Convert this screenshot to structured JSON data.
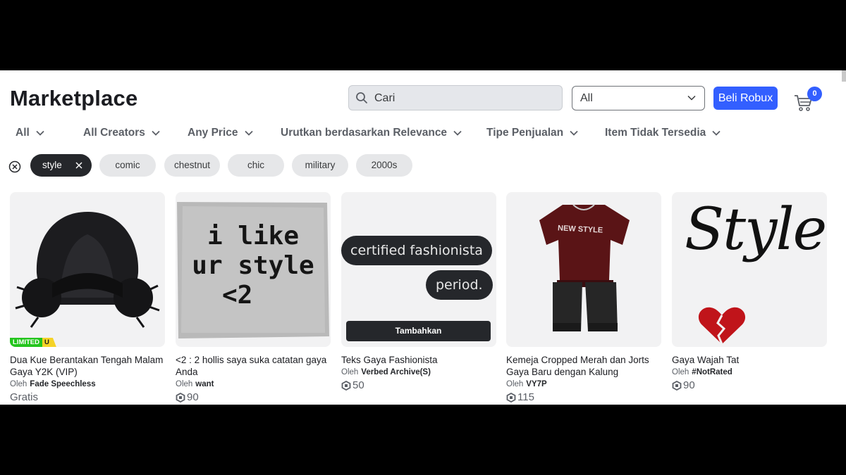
{
  "header": {
    "title": "Marketplace",
    "search_placeholder": "Cari",
    "category_select": "All",
    "buy_robux_label": "Beli Robux",
    "cart_count": "0"
  },
  "filters": [
    {
      "label": "All"
    },
    {
      "label": "All Creators"
    },
    {
      "label": "Any Price"
    },
    {
      "label": "Urutkan berdasarkan Relevance"
    },
    {
      "label": "Tipe Penjualan"
    },
    {
      "label": "Item Tidak Tersedia"
    }
  ],
  "chips": [
    "style",
    "comic",
    "chestnut",
    "chic",
    "military",
    "2000s"
  ],
  "items": [
    {
      "name": "Dua Kue Berantakan Tengah Malam Gaya Y2K (VIP)",
      "by": "Oleh",
      "creator": "Fade Speechless",
      "price": "Gratis",
      "badge": "LIMITED",
      "badge_suffix": "U"
    },
    {
      "name": "<2 : 2 hollis saya suka catatan gaya Anda",
      "by": "Oleh",
      "creator": "want",
      "price": "90",
      "thumb_text": [
        "i like",
        "ur style",
        "<2"
      ]
    },
    {
      "name": "Teks Gaya Fashionista",
      "by": "Oleh",
      "creator": "Verbed Archive(S)",
      "price": "50",
      "thumb_text": [
        "certified fashionista",
        "period."
      ],
      "hover_button": "Tambahkan"
    },
    {
      "name": "Kemeja Cropped Merah dan Jorts Gaya Baru dengan Kalung",
      "by": "Oleh",
      "creator": "VY7P",
      "price": "115",
      "thumb_text": [
        "NEW STYLE"
      ]
    },
    {
      "name": "Gaya Wajah Tat",
      "by": "Oleh",
      "creator": "#NotRated",
      "price": "90",
      "thumb_text": [
        "Style"
      ]
    }
  ],
  "colors": {
    "accent": "#335fff",
    "chip_active": "#25272b",
    "chip": "#e6e7e9",
    "limited_green": "#24c51d",
    "limited_yellow": "#f5d327"
  }
}
